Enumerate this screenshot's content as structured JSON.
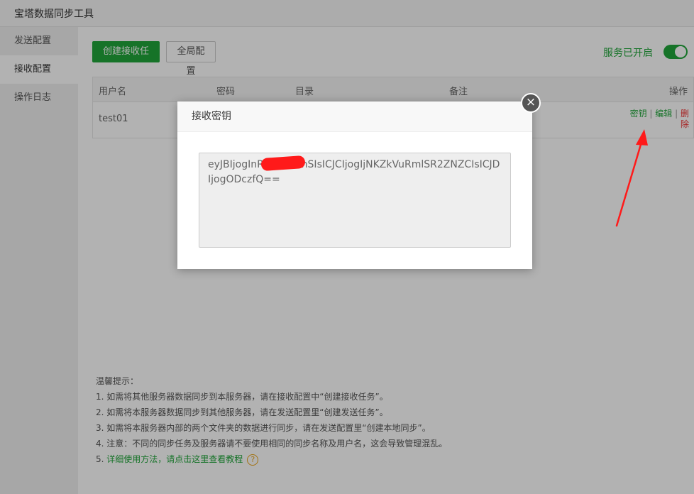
{
  "window": {
    "title": "宝塔数据同步工具"
  },
  "sidebar": {
    "items": [
      {
        "label": "发送配置"
      },
      {
        "label": "接收配置"
      },
      {
        "label": "操作日志"
      }
    ]
  },
  "toolbar": {
    "create_label": "创建接收任务",
    "global_label": "全局配置"
  },
  "service": {
    "status_label": "服务已开启",
    "enabled": true
  },
  "table": {
    "headers": {
      "username": "用户名",
      "password": "密码",
      "directory": "目录",
      "remark": "备注",
      "actions": "操作"
    },
    "rows": [
      {
        "username": "test01",
        "actions": {
          "key": "密钥",
          "edit": "编辑",
          "delete": "删\n除"
        }
      }
    ],
    "separator": "|"
  },
  "tips": {
    "title": "温馨提示：",
    "lines": [
      "1. 如需将其他服务器数据同步到本服务器，请在接收配置中“创建接收任务”。",
      "2. 如需将本服务器数据同步到其他服务器，请在发送配置里“创建发送任务”。",
      "3. 如需将本服务器内部的两个文件夹的数据进行同步，请在发送配置里“创建本地同步”。",
      "4. 注意：不同的同步任务及服务器请不要使用相同的同步名称及用户名，这会导致管理混乱。"
    ],
    "link_prefix": "5. ",
    "link_text": "详细使用方法，请点击这里查看教程",
    "help_glyph": "?"
  },
  "modal": {
    "title": "接收密钥",
    "close_glyph": "×",
    "key_value": "eyJBIjogInRl           nSIsICJCIjogIjNKZkVuRmlSR2ZNZCIsICJDIjogODczfQ=="
  },
  "colors": {
    "accent": "#20a53a",
    "danger": "#e33333",
    "annotation": "#ff1a1a"
  }
}
